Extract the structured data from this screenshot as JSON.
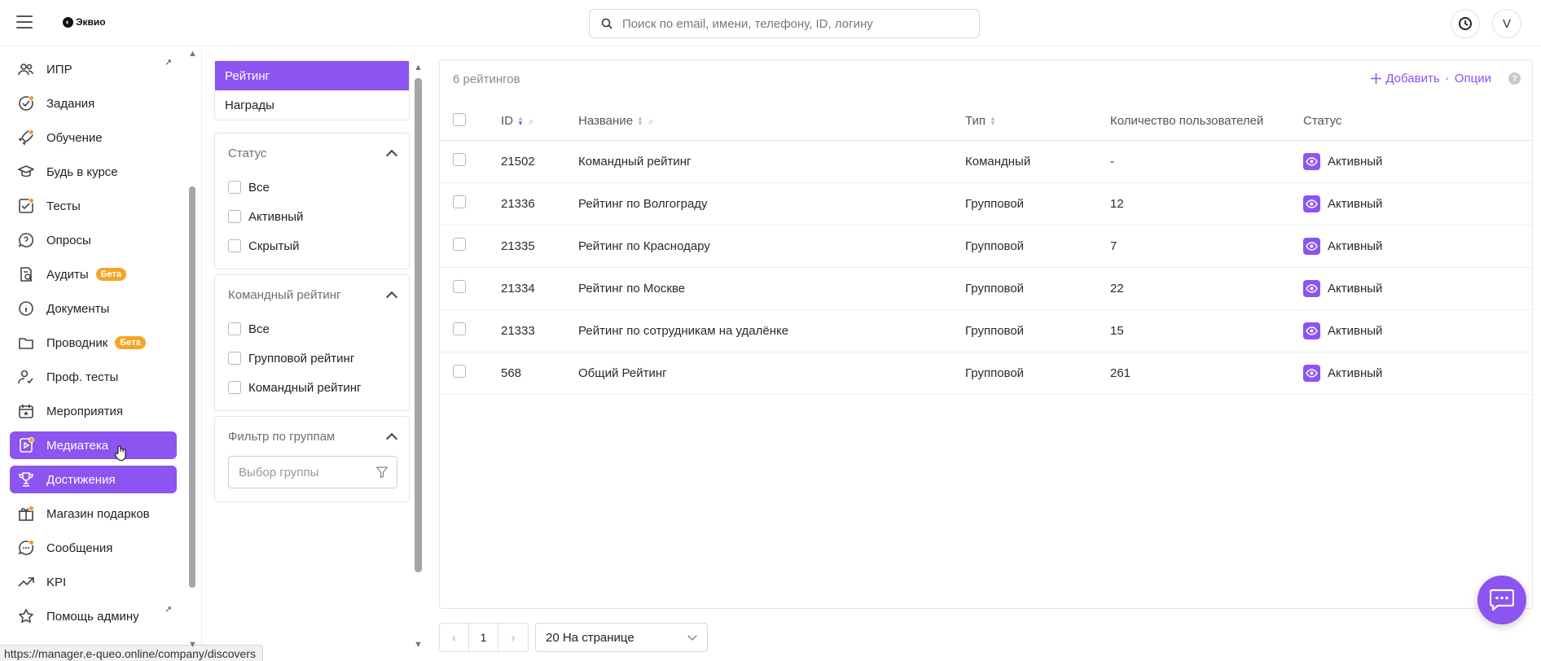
{
  "app": {
    "brand": "Эквио"
  },
  "search": {
    "placeholder": "Поиск по email, имени, телефону, ID, логину"
  },
  "user": {
    "avatar_initial": "V"
  },
  "sidebar": {
    "items": [
      {
        "label": "ИПР",
        "icon": "users-icon",
        "external": "↗"
      },
      {
        "label": "Задания",
        "icon": "check-circle-icon",
        "dot": true
      },
      {
        "label": "Обучение",
        "icon": "rocket-icon",
        "dot": true
      },
      {
        "label": "Будь в курсе",
        "icon": "graduation-cap-icon"
      },
      {
        "label": "Тесты",
        "icon": "checklist-icon",
        "dot": true
      },
      {
        "label": "Опросы",
        "icon": "question-bubble-icon"
      },
      {
        "label": "Аудиты",
        "icon": "audit-icon",
        "badge": "Бета"
      },
      {
        "label": "Документы",
        "icon": "info-circle-icon"
      },
      {
        "label": "Проводник",
        "icon": "folder-icon",
        "badge": "Бета"
      },
      {
        "label": "Проф. тесты",
        "icon": "person-check-icon"
      },
      {
        "label": "Мероприятия",
        "icon": "calendar-icon"
      },
      {
        "label": "Медиатека",
        "icon": "media-icon",
        "dot": true,
        "active": true
      },
      {
        "label": "Достижения",
        "icon": "trophy-icon",
        "active": true
      },
      {
        "label": "Магазин подарков",
        "icon": "gift-icon",
        "dot": true
      },
      {
        "label": "Сообщения",
        "icon": "chat-icon",
        "dot": true
      },
      {
        "label": "KPI",
        "icon": "trend-icon"
      },
      {
        "label": "Помощь админу",
        "icon": "star-icon",
        "external": "↗"
      }
    ]
  },
  "filters": {
    "tabs": [
      {
        "label": "Рейтинг",
        "active": true
      },
      {
        "label": "Награды",
        "active": false
      }
    ],
    "status": {
      "title": "Статус",
      "options": [
        "Все",
        "Активный",
        "Скрытый"
      ]
    },
    "team": {
      "title": "Командный рейтинг",
      "options": [
        "Все",
        "Групповой рейтинг",
        "Командный рейтинг"
      ]
    },
    "groups": {
      "title": "Фильтр по группам",
      "placeholder": "Выбор группы"
    }
  },
  "table": {
    "count_label": "6 рейтингов",
    "add_label": "Добавить",
    "options_label": "Опции",
    "help_label": "?",
    "columns": [
      "ID",
      "Название",
      "Тип",
      "Количество пользователей",
      "Статус"
    ],
    "rows": [
      {
        "id": "21502",
        "name": "Командный рейтинг",
        "type": "Командный",
        "users": "-",
        "status": "Активный"
      },
      {
        "id": "21336",
        "name": "Рейтинг по Волгограду",
        "type": "Групповой",
        "users": "12",
        "status": "Активный"
      },
      {
        "id": "21335",
        "name": "Рейтинг по Краснодару",
        "type": "Групповой",
        "users": "7",
        "status": "Активный"
      },
      {
        "id": "21334",
        "name": "Рейтинг по Москве",
        "type": "Групповой",
        "users": "22",
        "status": "Активный"
      },
      {
        "id": "21333",
        "name": "Рейтинг по сотрудникам на удалёнке",
        "type": "Групповой",
        "users": "15",
        "status": "Активный"
      },
      {
        "id": "568",
        "name": "Общий Рейтинг",
        "type": "Групповой",
        "users": "261",
        "status": "Активный"
      }
    ]
  },
  "pagination": {
    "current_page": "1",
    "prev": "‹",
    "next": "›",
    "per_page": "20 На странице"
  },
  "statusbar": {
    "url": "https://manager.e-queo.online/company/discovers"
  },
  "colors": {
    "accent": "#8c54f0",
    "beta_badge": "#f5a623",
    "dot": "#f39a1e"
  }
}
